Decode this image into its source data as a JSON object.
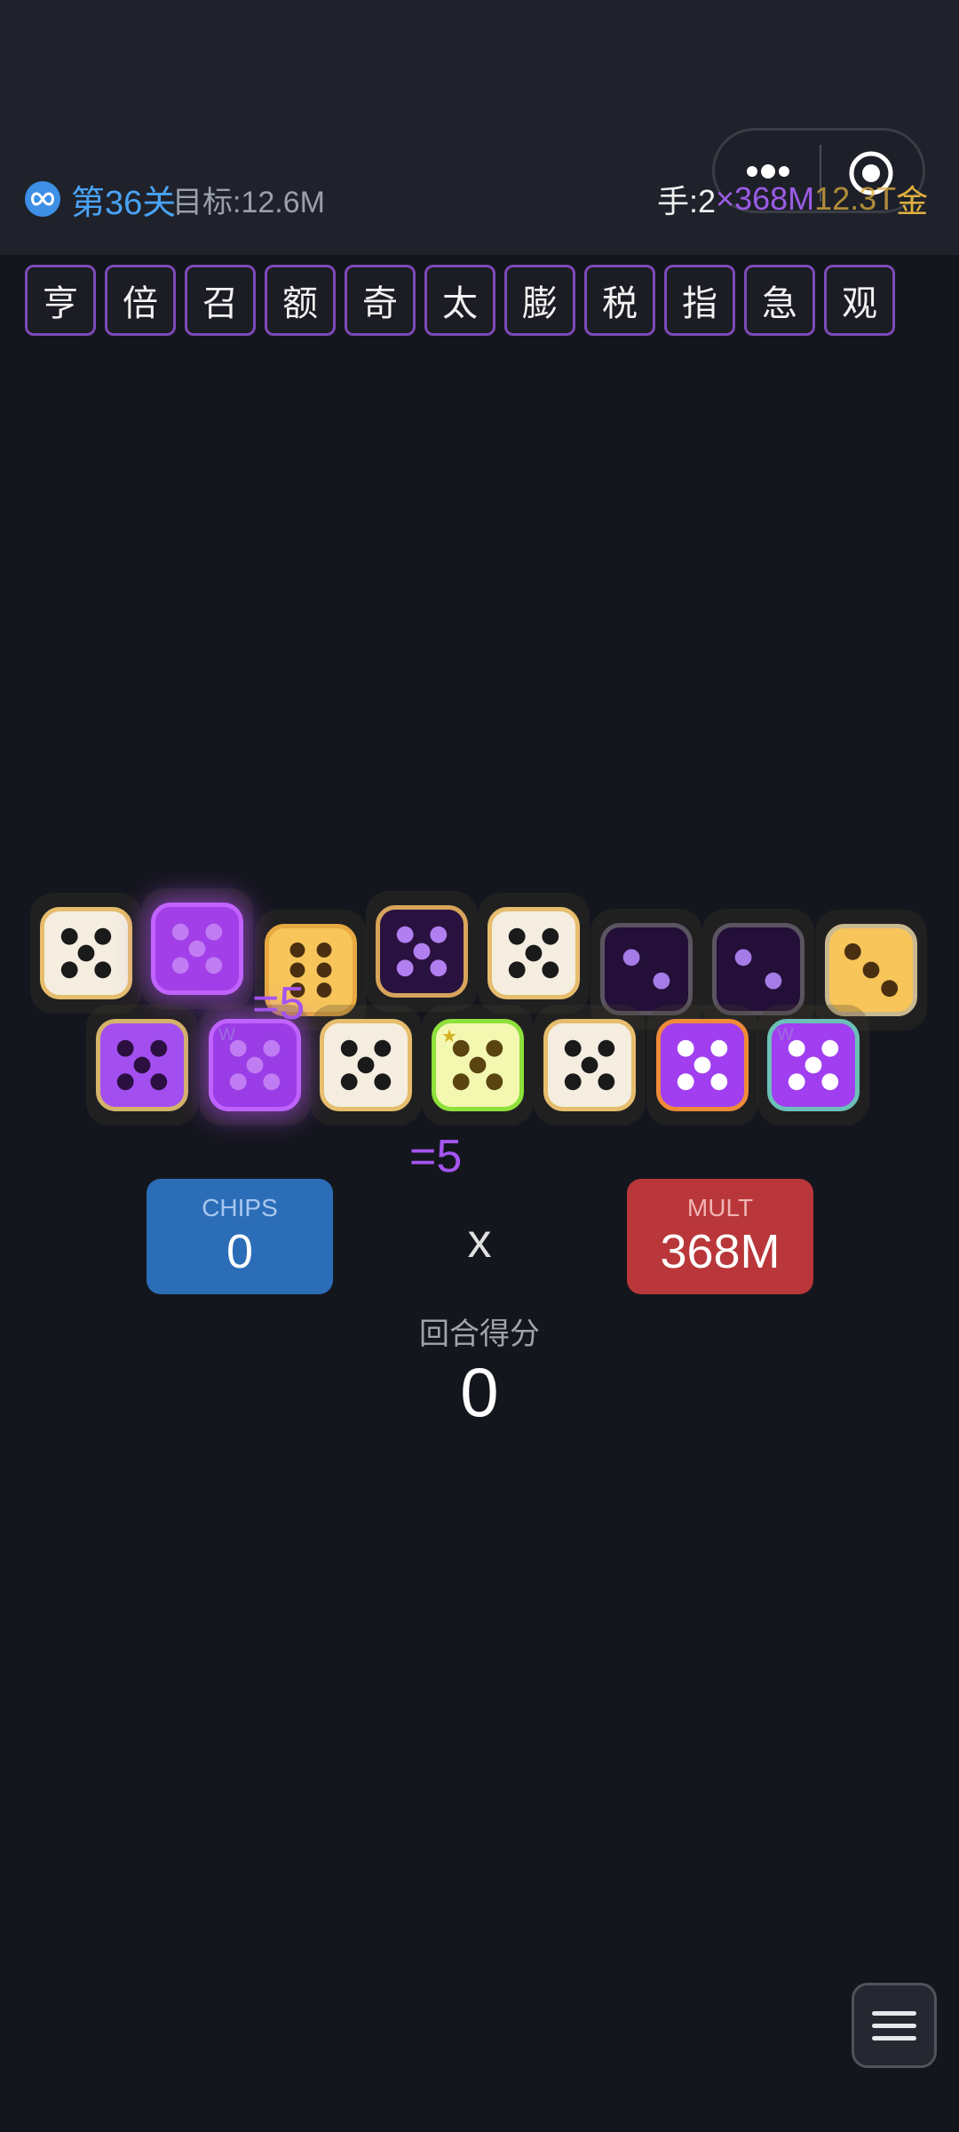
{
  "header": {
    "level": "第36关",
    "goal": "目标:12.6M",
    "hands": "手:2",
    "mult": "×368M",
    "gold_value": "12.3T",
    "gold_unit": "金"
  },
  "relics": [
    "亨",
    "倍",
    "召",
    "额",
    "奇",
    "太",
    "膨",
    "税",
    "指",
    "急",
    "观"
  ],
  "dice_top": [
    {
      "pips": 5,
      "face": "#f4ede0",
      "border": "#e6bd6d",
      "pip": "#1a1a1a"
    },
    {
      "pips": 5,
      "face": "#a23fe8",
      "border": "#c063ff",
      "pip": "#c07cf2",
      "glow": true
    },
    {
      "pips": 6,
      "face": "#f7c55a",
      "border": "#e7a940",
      "pip": "#4a3010"
    },
    {
      "pips": 5,
      "face": "#2a1240",
      "border": "#d7a45a",
      "pip": "#b27ff0"
    },
    {
      "pips": 5,
      "face": "#f4ede0",
      "border": "#e6bd6d",
      "pip": "#1a1a1a"
    },
    {
      "pips": 2,
      "face": "#230f38",
      "border": "#5a5560",
      "pip": "#a57be8"
    },
    {
      "pips": 2,
      "face": "#230f38",
      "border": "#5a5560",
      "pip": "#a57be8"
    },
    {
      "pips": 3,
      "face": "#f7c55a",
      "border": "#c9b890",
      "pip": "#4a3010"
    }
  ],
  "dice_bottom": [
    {
      "pips": 5,
      "face": "#a34ff0",
      "border": "#d4b36a",
      "pip": "#2a0f40"
    },
    {
      "pips": 5,
      "face": "#9a3de6",
      "border": "#c063ff",
      "pip": "#c07cf2",
      "glow": true,
      "badge": "W"
    },
    {
      "pips": 5,
      "face": "#f4ede0",
      "border": "#e6bd6d",
      "pip": "#1a1a1a"
    },
    {
      "pips": 5,
      "face": "#f3f7b0",
      "border": "#8ee03a",
      "pip": "#5a4410",
      "badge": "★"
    },
    {
      "pips": 5,
      "face": "#f4ede0",
      "border": "#e6bd6d",
      "pip": "#1a1a1a"
    },
    {
      "pips": 5,
      "face": "#a03ef0",
      "border": "#ef8a3a",
      "pip": "#ffffff"
    },
    {
      "pips": 5,
      "face": "#a03ef0",
      "border": "#6bc0b8",
      "pip": "#ffffff",
      "badge": "W"
    }
  ],
  "popups": [
    "=5",
    "=5"
  ],
  "score": {
    "chips_label": "CHIPS",
    "chips_value": "0",
    "times": "x",
    "mult_label": "MULT",
    "mult_value": "368M",
    "round_label": "回合得分",
    "round_value": "0"
  }
}
